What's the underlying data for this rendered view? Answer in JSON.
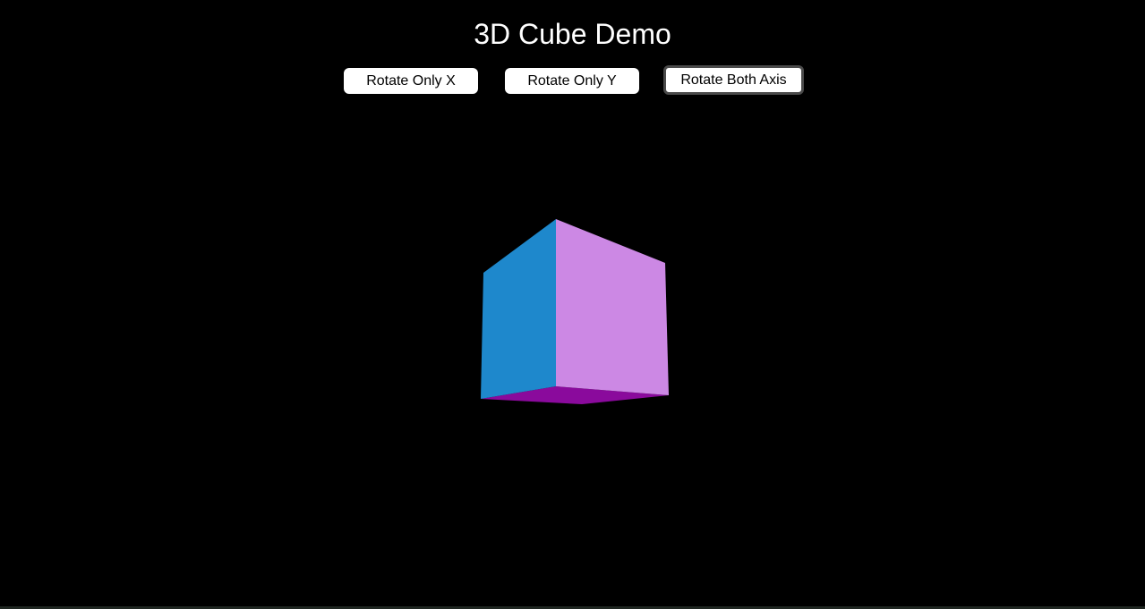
{
  "header": {
    "title": "3D Cube Demo"
  },
  "controls": {
    "rotate_x_label": "Rotate Only X",
    "rotate_y_label": "Rotate Only Y",
    "rotate_both_label": "Rotate Both Axis"
  },
  "cube": {
    "faces": {
      "left": {
        "color": "#1e88cc"
      },
      "right": {
        "color": "#cc88e4"
      },
      "bottom": {
        "color": "#8a0a9c"
      }
    }
  },
  "colors": {
    "background": "#000000",
    "title_text": "#ffffff",
    "button_bg": "#ffffff",
    "button_text": "#000000",
    "active_button_border": "#4a4a4a"
  }
}
